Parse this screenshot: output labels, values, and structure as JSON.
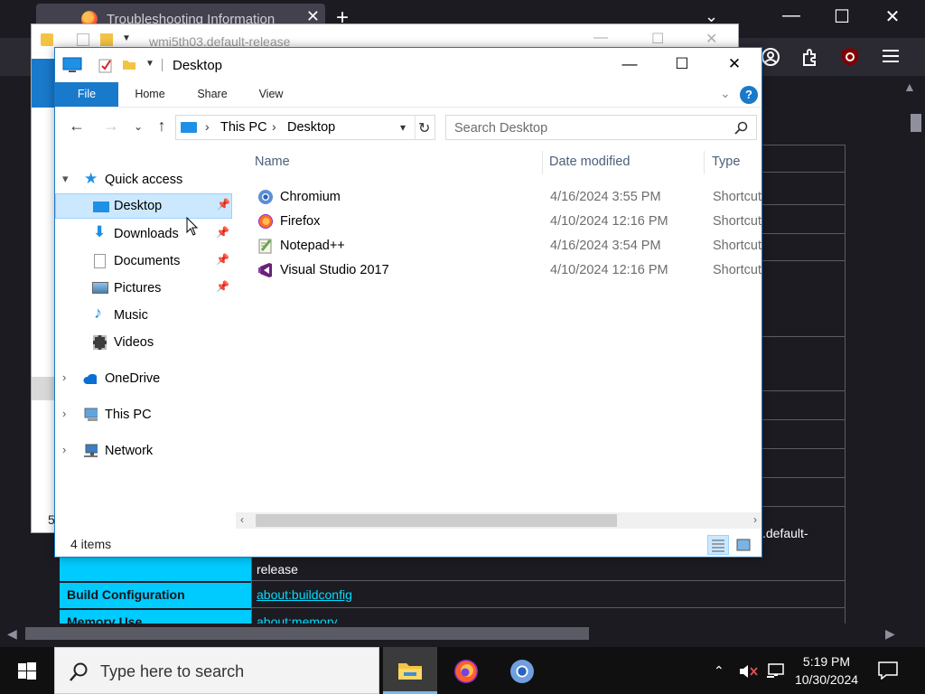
{
  "browser": {
    "tab_title": "Troubleshooting Information",
    "tab_close": "✕",
    "new_tab": "+",
    "tab_list": "⌄",
    "minimize": "—",
    "maximize": "☐",
    "close": "✕",
    "rows": [
      {
        "label": "",
        "value": "release"
      },
      {
        "label": "Build Configuration",
        "value": "about:buildconfig"
      },
      {
        "label": "Memory Use",
        "value": "about:memory"
      }
    ],
    "row_fragment": ".default-"
  },
  "explorer_back": {
    "title": "wmi5th03.default-release",
    "minimize": "—",
    "maximize": "☐",
    "close": "✕",
    "item_count_fragment": "5"
  },
  "explorer": {
    "title": "Desktop",
    "minimize": "—",
    "maximize": "☐",
    "close": "✕",
    "ribbon": {
      "file": "File",
      "home": "Home",
      "share": "Share",
      "view": "View",
      "help": "?"
    },
    "address": {
      "this_pc": "This PC",
      "current": "Desktop"
    },
    "search_placeholder": "Search Desktop",
    "nav": {
      "quick_access": "Quick access",
      "desktop": "Desktop",
      "downloads": "Downloads",
      "documents": "Documents",
      "pictures": "Pictures",
      "music": "Music",
      "videos": "Videos",
      "onedrive": "OneDrive",
      "this_pc": "This PC",
      "network": "Network"
    },
    "columns": {
      "name": "Name",
      "date": "Date modified",
      "type": "Type"
    },
    "files": [
      {
        "name": "Chromium",
        "date": "4/16/2024 3:55 PM",
        "type": "Shortcut",
        "icon": "chromium-icon"
      },
      {
        "name": "Firefox",
        "date": "4/10/2024 12:16 PM",
        "type": "Shortcut",
        "icon": "firefox-icon"
      },
      {
        "name": "Notepad++",
        "date": "4/16/2024 3:54 PM",
        "type": "Shortcut",
        "icon": "notepadpp-icon"
      },
      {
        "name": "Visual Studio 2017",
        "date": "4/10/2024 12:16 PM",
        "type": "Shortcut",
        "icon": "visualstudio-icon"
      }
    ],
    "status": "4 items"
  },
  "taskbar": {
    "search_placeholder": "Type here to search",
    "time": "5:19 PM",
    "date": "10/30/2024",
    "accent": "#76b9ed"
  }
}
